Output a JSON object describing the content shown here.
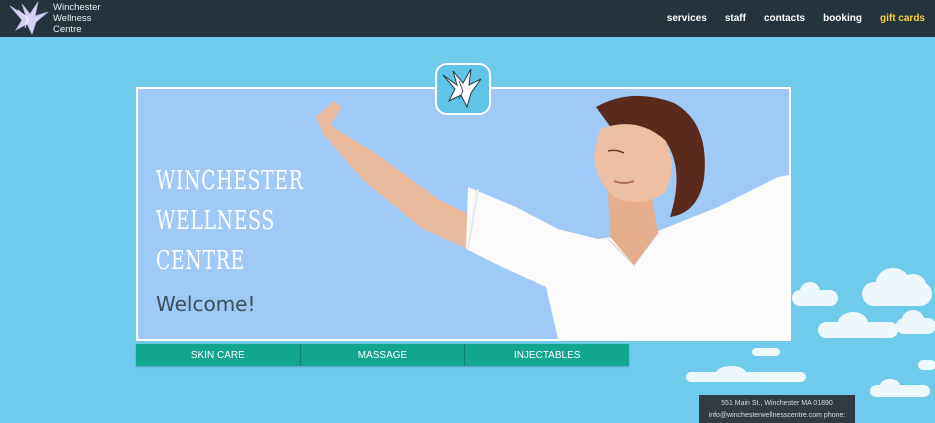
{
  "site": {
    "brand_lines": [
      "Winchester",
      "Wellness",
      "Centre"
    ]
  },
  "nav": {
    "items": [
      {
        "label": "services"
      },
      {
        "label": "staff"
      },
      {
        "label": "contacts"
      },
      {
        "label": "booking"
      },
      {
        "label": "gift cards"
      }
    ],
    "gift_color": "#f6d33b"
  },
  "hero": {
    "title_lines": [
      "Winchester",
      "Wellness",
      "Centre"
    ],
    "welcome": "Welcome!",
    "background_color": "#9fc9f7"
  },
  "services": {
    "buttons": [
      {
        "label": "SKIN CARE"
      },
      {
        "label": "MASSAGE"
      },
      {
        "label": "INJECTABLES"
      }
    ],
    "color": "#13a58e"
  },
  "footer": {
    "address": "551 Main St., Winchester MA 01890",
    "contact": "info@winchesterwellnesscentre.com phone:"
  },
  "colors": {
    "sky": "#6ecbec",
    "navbar": "#25333c"
  },
  "icons": [
    "bird-logo-icon",
    "bird-badge-icon"
  ]
}
